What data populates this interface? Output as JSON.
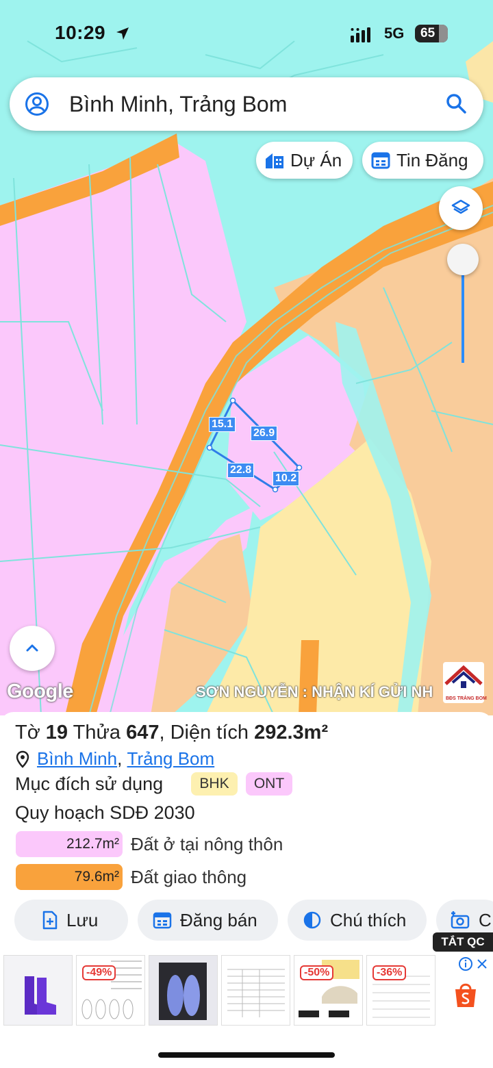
{
  "status_bar": {
    "time": "10:29",
    "network": "5G",
    "battery": "65"
  },
  "search": {
    "query": "Bình Minh, Trảng Bom"
  },
  "map_buttons": {
    "du_an": "Dự Án",
    "tin_dang": "Tin Đăng"
  },
  "map_overlay": {
    "google": "Google",
    "watermark": "SƠN NGUYỄN : NHẬN KÍ GỬI NH",
    "logo_text": "BĐS TRẢNG BOM"
  },
  "parcel_dimensions": [
    "15.1",
    "26.9",
    "22.8",
    "10.2"
  ],
  "parcel": {
    "to_label": "Tờ",
    "to_value": "19",
    "thua_label": "Thửa",
    "thua_value": "647",
    "area_label": "Diện tích",
    "area_value": "292.3m²",
    "commune": "Bình Minh",
    "district": "Trảng Bom",
    "usage_label": "Mục đích sử dụng",
    "usage_tags": [
      "BHK",
      "ONT"
    ],
    "plan_label": "Quy hoạch SDĐ 2030",
    "plans": [
      {
        "area": "212.7m²",
        "label": "Đất ở tại nông thôn",
        "color": "#fbc8fb"
      },
      {
        "area": "79.6m²",
        "label": "Đất giao thông",
        "color": "#f9a23c"
      }
    ]
  },
  "actions": {
    "save": "Lưu",
    "sell": "Đăng bán",
    "legend": "Chú thích",
    "camera": "C"
  },
  "ads": {
    "close_label": "TẮT QC",
    "discounts": [
      "-49%",
      "-50%",
      "-36%"
    ]
  },
  "colors": {
    "accent": "#1a73e8",
    "road": "#f9a23c",
    "residential": "#fbc8fb",
    "water": "#9ef3ee"
  }
}
